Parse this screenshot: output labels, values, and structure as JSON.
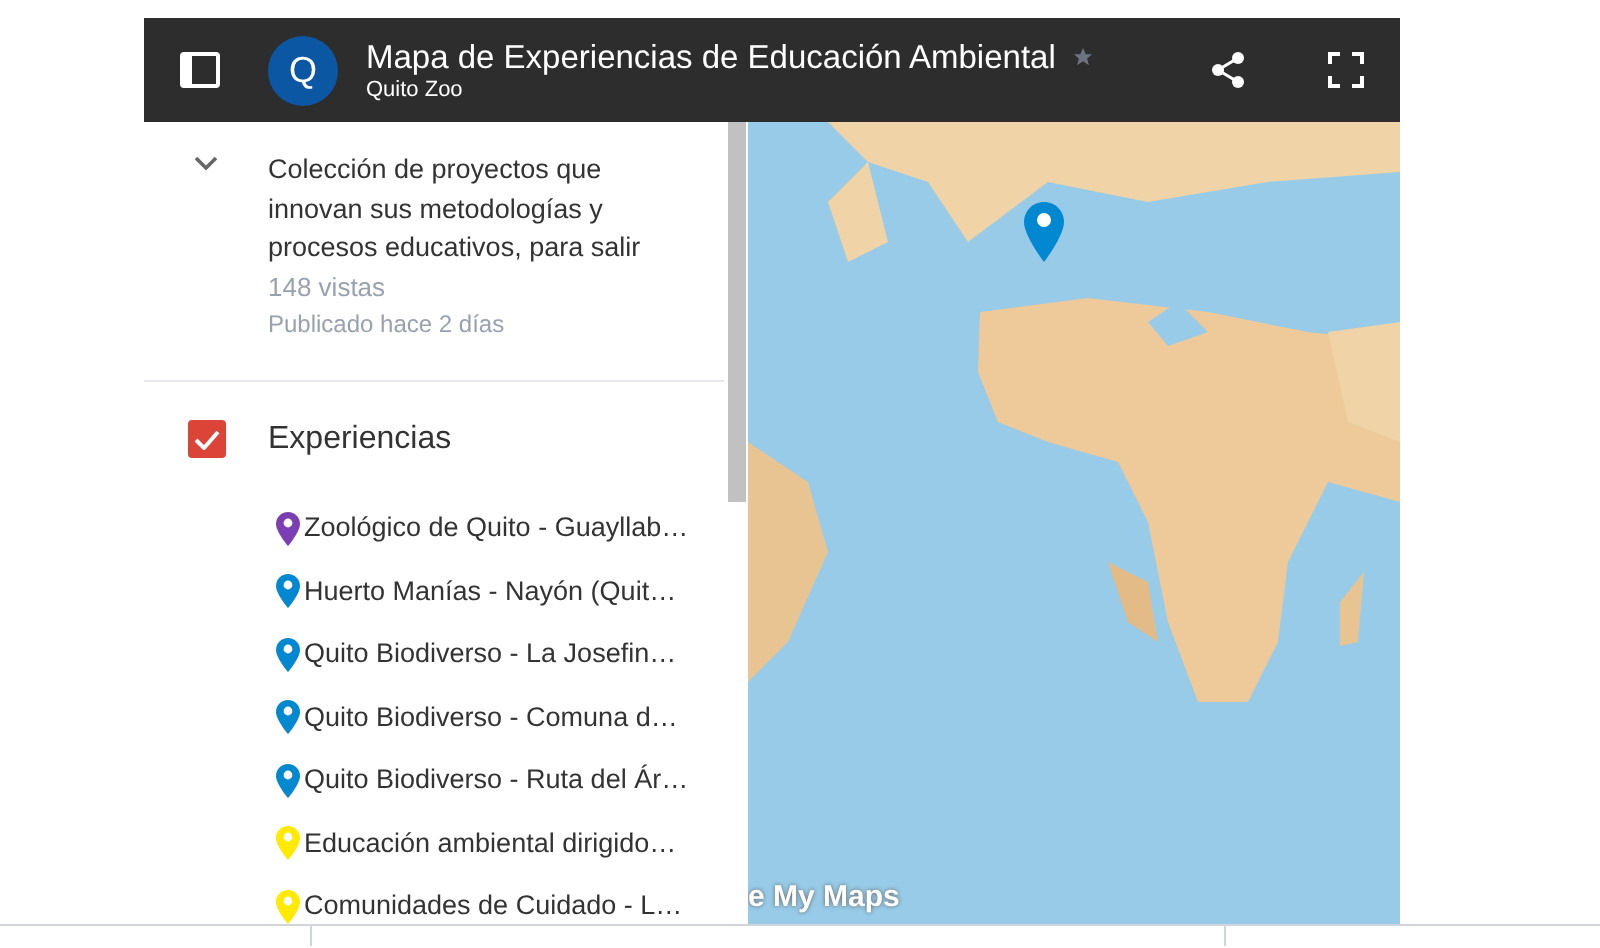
{
  "header": {
    "title": "Mapa de Experiencias de Educación Ambiental",
    "owner": "Quito Zoo",
    "avatar": "Q",
    "starred": false
  },
  "description": {
    "expanded": true,
    "text": "Colección de proyectos que innovan sus metodologías y procesos educativos, para salir",
    "views": "148 vistas",
    "published": "Publicado hace 2 días"
  },
  "layer": {
    "name": "Experiencias",
    "checked": true,
    "items": [
      {
        "label": "Zoológico de Quito - Guayllab…",
        "color": "#7b3fb3"
      },
      {
        "label": "Huerto Manías - Nayón (Quit…",
        "color": "#0288d1"
      },
      {
        "label": "Quito Biodiverso - La Josefin…",
        "color": "#0288d1"
      },
      {
        "label": "Quito Biodiverso - Comuna d…",
        "color": "#0288d1"
      },
      {
        "label": "Quito Biodiverso - Ruta del Ár…",
        "color": "#0288d1"
      },
      {
        "label": "Educación ambiental dirigido…",
        "color": "#ffea00"
      },
      {
        "label": "Comunidades de Cuidado - L…",
        "color": "#ffea00"
      }
    ]
  },
  "map": {
    "logo": "e My Maps"
  }
}
